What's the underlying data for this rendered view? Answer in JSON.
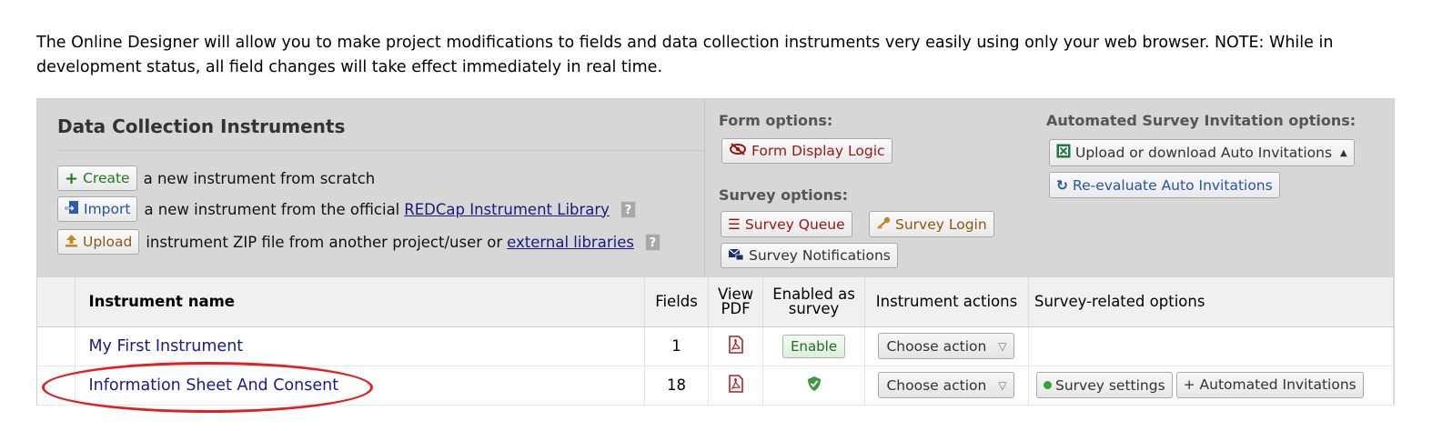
{
  "intro_text": "The Online Designer will allow you to make project modifications to fields and data collection instruments very easily using only your web browser. NOTE: While in development status, all field changes will take effect immediately in real time.",
  "panel": {
    "title": "Data Collection Instruments",
    "create": {
      "icon": "+",
      "label": "Create",
      "text": "a new instrument from scratch"
    },
    "import": {
      "icon": "import-icon",
      "label": "Import",
      "text": "a new instrument from the official",
      "link": "REDCap Instrument Library",
      "help": "?"
    },
    "upload": {
      "icon": "upload-icon",
      "label": "Upload",
      "text": "instrument ZIP file from another project/user or",
      "link": "external libraries",
      "help": "?"
    }
  },
  "form_options": {
    "label": "Form options:",
    "form_display_logic": "Form Display Logic"
  },
  "survey_options": {
    "label": "Survey options:",
    "survey_queue": "Survey Queue",
    "survey_login": "Survey Login",
    "survey_notifications": "Survey Notifications"
  },
  "asi_options": {
    "label": "Automated Survey Invitation options:",
    "upload_download": "Upload or download Auto Invitations",
    "reevaluate": "Re-evaluate Auto Invitations"
  },
  "table": {
    "headers": {
      "name": "Instrument name",
      "fields": "Fields",
      "view_pdf_1": "View",
      "view_pdf_2": "PDF",
      "enabled_1": "Enabled as",
      "enabled_2": "survey",
      "actions": "Instrument actions",
      "survey_related": "Survey-related options"
    },
    "rows": [
      {
        "name": "My First Instrument",
        "fields": "1",
        "enable_label": "Enable",
        "action": "Choose action"
      },
      {
        "name": "Information Sheet And Consent",
        "fields": "18",
        "action": "Choose action",
        "survey_settings": "Survey settings",
        "auto_invitations": "+ Automated Invitations"
      }
    ]
  },
  "colors": {
    "highlight_oval": "#e02020",
    "panel_bg": "#d7d7d7"
  }
}
